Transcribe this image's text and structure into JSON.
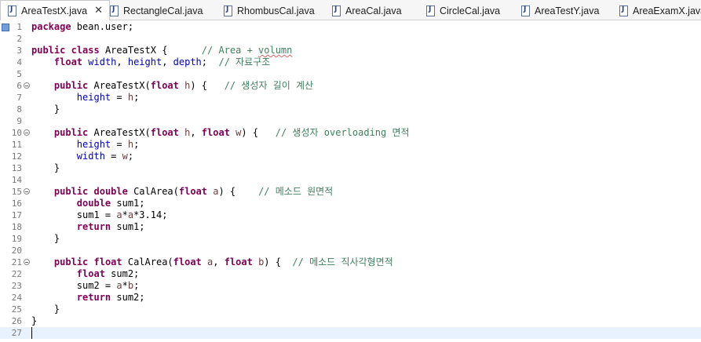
{
  "tabs": [
    {
      "label": "AreaTestX.java",
      "active": true
    },
    {
      "label": "RectangleCal.java"
    },
    {
      "label": "RhombusCal.java"
    },
    {
      "label": "AreaCal.java"
    },
    {
      "label": "CircleCal.java"
    },
    {
      "label": "AreaTestY.java"
    },
    {
      "label": "AreaExamX.java"
    }
  ],
  "close_glyph": "✕",
  "lines": [
    {
      "n": "1",
      "tokens": [
        [
          "kw",
          "package"
        ],
        [
          "",
          " bean.user;"
        ]
      ]
    },
    {
      "n": "2",
      "tokens": []
    },
    {
      "n": "3",
      "tokens": [
        [
          "kw",
          "public"
        ],
        [
          "",
          " "
        ],
        [
          "kw",
          "class"
        ],
        [
          "",
          " AreaTestX {      "
        ],
        [
          "cmt",
          "// Area + "
        ],
        [
          "cmt spell",
          "volumn"
        ]
      ]
    },
    {
      "n": "4",
      "tokens": [
        [
          "",
          "    "
        ],
        [
          "kw",
          "float"
        ],
        [
          "",
          " "
        ],
        [
          "fld",
          "width"
        ],
        [
          "",
          ", "
        ],
        [
          "fld",
          "height"
        ],
        [
          "",
          ", "
        ],
        [
          "fld",
          "depth"
        ],
        [
          "",
          ";  "
        ],
        [
          "cmt",
          "// 자료구조"
        ]
      ]
    },
    {
      "n": "5",
      "tokens": []
    },
    {
      "n": "6",
      "fold": true,
      "tokens": [
        [
          "",
          "    "
        ],
        [
          "kw",
          "public"
        ],
        [
          "",
          " AreaTestX("
        ],
        [
          "kw",
          "float"
        ],
        [
          "",
          " "
        ],
        [
          "prm",
          "h"
        ],
        [
          "",
          ") {   "
        ],
        [
          "cmt",
          "// 생성자 길이 계산"
        ]
      ]
    },
    {
      "n": "7",
      "tokens": [
        [
          "",
          "        "
        ],
        [
          "fld",
          "height"
        ],
        [
          "",
          " = "
        ],
        [
          "prm",
          "h"
        ],
        [
          "",
          ";"
        ]
      ]
    },
    {
      "n": "8",
      "tokens": [
        [
          "",
          "    }"
        ]
      ]
    },
    {
      "n": "9",
      "tokens": []
    },
    {
      "n": "10",
      "fold": true,
      "tokens": [
        [
          "",
          "    "
        ],
        [
          "kw",
          "public"
        ],
        [
          "",
          " AreaTestX("
        ],
        [
          "kw",
          "float"
        ],
        [
          "",
          " "
        ],
        [
          "prm",
          "h"
        ],
        [
          "",
          ", "
        ],
        [
          "kw",
          "float"
        ],
        [
          "",
          " "
        ],
        [
          "prm",
          "w"
        ],
        [
          "",
          ") {   "
        ],
        [
          "cmt",
          "// 생성자 overloading 면적"
        ]
      ]
    },
    {
      "n": "11",
      "tokens": [
        [
          "",
          "        "
        ],
        [
          "fld",
          "height"
        ],
        [
          "",
          " = "
        ],
        [
          "prm",
          "h"
        ],
        [
          "",
          ";"
        ]
      ]
    },
    {
      "n": "12",
      "tokens": [
        [
          "",
          "        "
        ],
        [
          "fld",
          "width"
        ],
        [
          "",
          " = "
        ],
        [
          "prm",
          "w"
        ],
        [
          "",
          ";"
        ]
      ]
    },
    {
      "n": "13",
      "tokens": [
        [
          "",
          "    }"
        ]
      ]
    },
    {
      "n": "14",
      "tokens": []
    },
    {
      "n": "15",
      "fold": true,
      "tokens": [
        [
          "",
          "    "
        ],
        [
          "kw",
          "public"
        ],
        [
          "",
          " "
        ],
        [
          "kw",
          "double"
        ],
        [
          "",
          " CalArea("
        ],
        [
          "kw",
          "float"
        ],
        [
          "",
          " "
        ],
        [
          "prm",
          "a"
        ],
        [
          "",
          ") {    "
        ],
        [
          "cmt",
          "// 메소드 원면적"
        ]
      ]
    },
    {
      "n": "16",
      "tokens": [
        [
          "",
          "        "
        ],
        [
          "kw",
          "double"
        ],
        [
          "",
          " sum1;"
        ]
      ]
    },
    {
      "n": "17",
      "tokens": [
        [
          "",
          "        sum1 = "
        ],
        [
          "prm",
          "a"
        ],
        [
          "",
          "*"
        ],
        [
          "prm",
          "a"
        ],
        [
          "",
          "*3.14;"
        ]
      ]
    },
    {
      "n": "18",
      "tokens": [
        [
          "",
          "        "
        ],
        [
          "kw",
          "return"
        ],
        [
          "",
          " sum1;"
        ]
      ]
    },
    {
      "n": "19",
      "tokens": [
        [
          "",
          "    }"
        ]
      ]
    },
    {
      "n": "20",
      "tokens": []
    },
    {
      "n": "21",
      "fold": true,
      "tokens": [
        [
          "",
          "    "
        ],
        [
          "kw",
          "public"
        ],
        [
          "",
          " "
        ],
        [
          "kw",
          "float"
        ],
        [
          "",
          " CalArea("
        ],
        [
          "kw",
          "float"
        ],
        [
          "",
          " "
        ],
        [
          "prm",
          "a"
        ],
        [
          "",
          ", "
        ],
        [
          "kw",
          "float"
        ],
        [
          "",
          " "
        ],
        [
          "prm",
          "b"
        ],
        [
          "",
          ") {  "
        ],
        [
          "cmt",
          "// 메소드 직사각형면적"
        ]
      ]
    },
    {
      "n": "22",
      "tokens": [
        [
          "",
          "        "
        ],
        [
          "kw",
          "float"
        ],
        [
          "",
          " sum2;"
        ]
      ]
    },
    {
      "n": "23",
      "tokens": [
        [
          "",
          "        sum2 = "
        ],
        [
          "prm",
          "a"
        ],
        [
          "",
          "*"
        ],
        [
          "prm",
          "b"
        ],
        [
          "",
          ";"
        ]
      ]
    },
    {
      "n": "24",
      "tokens": [
        [
          "",
          "        "
        ],
        [
          "kw",
          "return"
        ],
        [
          "",
          " sum2;"
        ]
      ]
    },
    {
      "n": "25",
      "tokens": [
        [
          "",
          "    }"
        ]
      ]
    },
    {
      "n": "26",
      "tokens": [
        [
          "",
          "}"
        ]
      ]
    },
    {
      "n": "27",
      "current": true,
      "tokens": []
    }
  ],
  "colors": {
    "keyword": "#7f0055",
    "field": "#0000c0",
    "parameter": "#6a3e3e",
    "comment": "#3f7f5f",
    "current_line": "#e8f2fe"
  }
}
